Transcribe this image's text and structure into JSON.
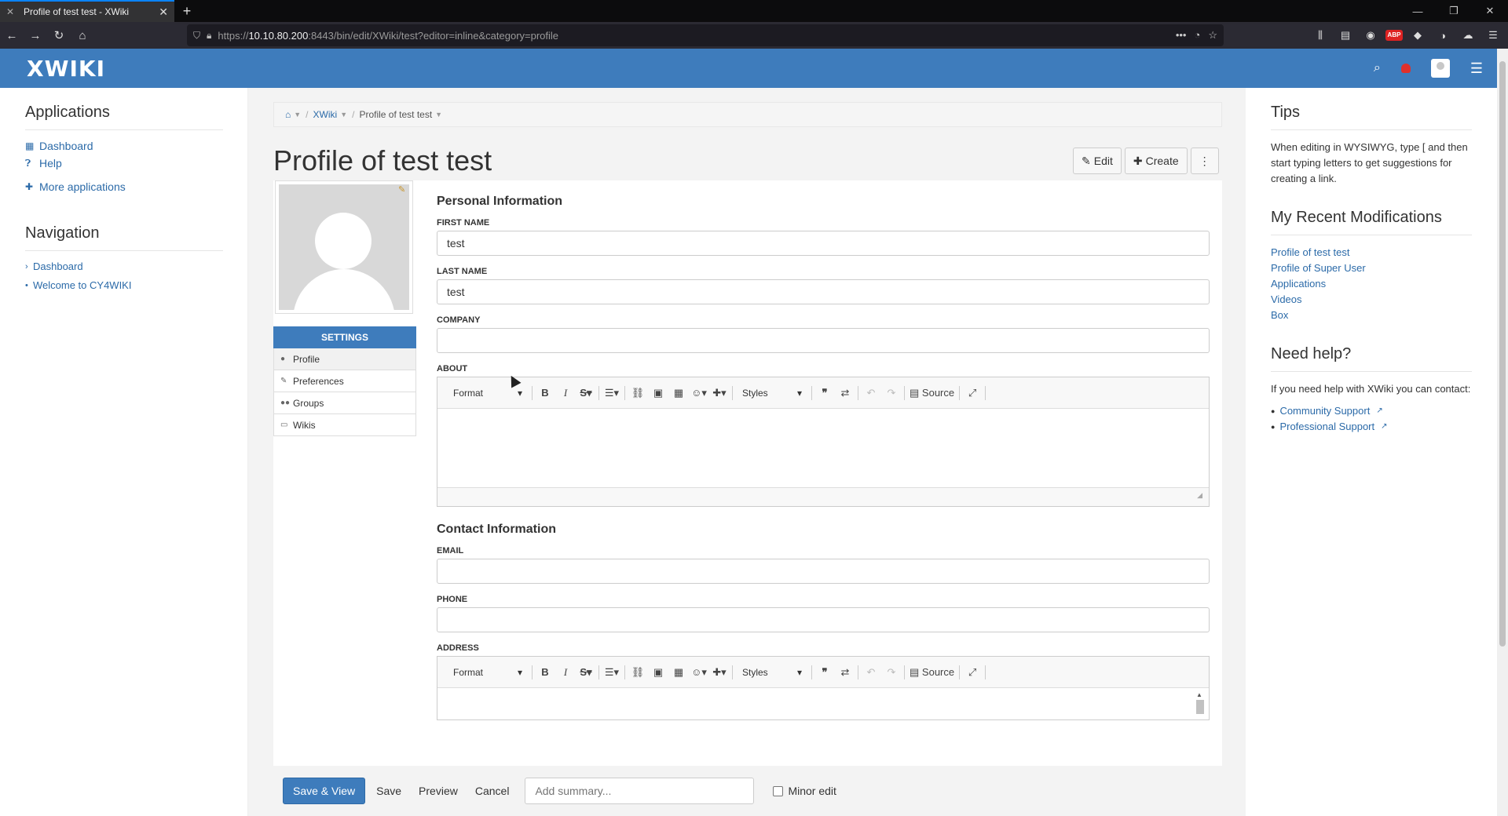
{
  "browser": {
    "tab_title": "Profile of test test - XWiki",
    "url_prefix": "https://",
    "url_host": "10.10.80.200",
    "url_rest": ":8443/bin/edit/XWiki/test?editor=inline&category=profile"
  },
  "header": {
    "logo": "XWIKI"
  },
  "left": {
    "applications_title": "Applications",
    "applications": [
      {
        "label": "Dashboard",
        "icon": "grid-icon"
      },
      {
        "label": "Help",
        "icon": "question-circle-icon"
      },
      {
        "label": "More applications",
        "icon": "plus-icon"
      }
    ],
    "navigation_title": "Navigation",
    "navigation": [
      {
        "label": "Dashboard",
        "icon": "chevron-right-icon"
      },
      {
        "label": "Welcome to CY4WIKI",
        "icon": "bullet-icon"
      }
    ]
  },
  "breadcrumb": {
    "xwiki": "XWiki",
    "current": "Profile of test test"
  },
  "page": {
    "title": "Profile of test test",
    "edit_label": "Edit",
    "create_label": "Create"
  },
  "settings": {
    "header": "SETTINGS",
    "items": [
      "Profile",
      "Preferences",
      "Groups",
      "Wikis"
    ]
  },
  "form": {
    "personal_title": "Personal Information",
    "first_name_label": "FIRST NAME",
    "first_name_value": "test",
    "last_name_label": "LAST NAME",
    "last_name_value": "test",
    "company_label": "COMPANY",
    "company_value": "",
    "about_label": "ABOUT",
    "contact_title": "Contact Information",
    "email_label": "EMAIL",
    "email_value": "",
    "phone_label": "PHONE",
    "phone_value": "",
    "address_label": "ADDRESS"
  },
  "editor_toolbar": {
    "format": "Format",
    "styles": "Styles",
    "source": "Source"
  },
  "bottom": {
    "save_view": "Save & View",
    "save": "Save",
    "preview": "Preview",
    "cancel": "Cancel",
    "summary_placeholder": "Add summary...",
    "minor_edit": "Minor edit"
  },
  "right": {
    "tips_title": "Tips",
    "tips_text": "When editing in WYSIWYG, type [ and then start typing letters to get suggestions for creating a link.",
    "recent_title": "My Recent Modifications",
    "recent": [
      "Profile of test test",
      "Profile of Super User",
      "Applications",
      "Videos",
      "Box"
    ],
    "help_title": "Need help?",
    "help_text": "If you need help with XWiki you can contact:",
    "help_links": [
      "Community Support",
      "Professional Support"
    ]
  },
  "colors": {
    "brand": "#3e7cbc",
    "link": "#2b6aa8"
  }
}
